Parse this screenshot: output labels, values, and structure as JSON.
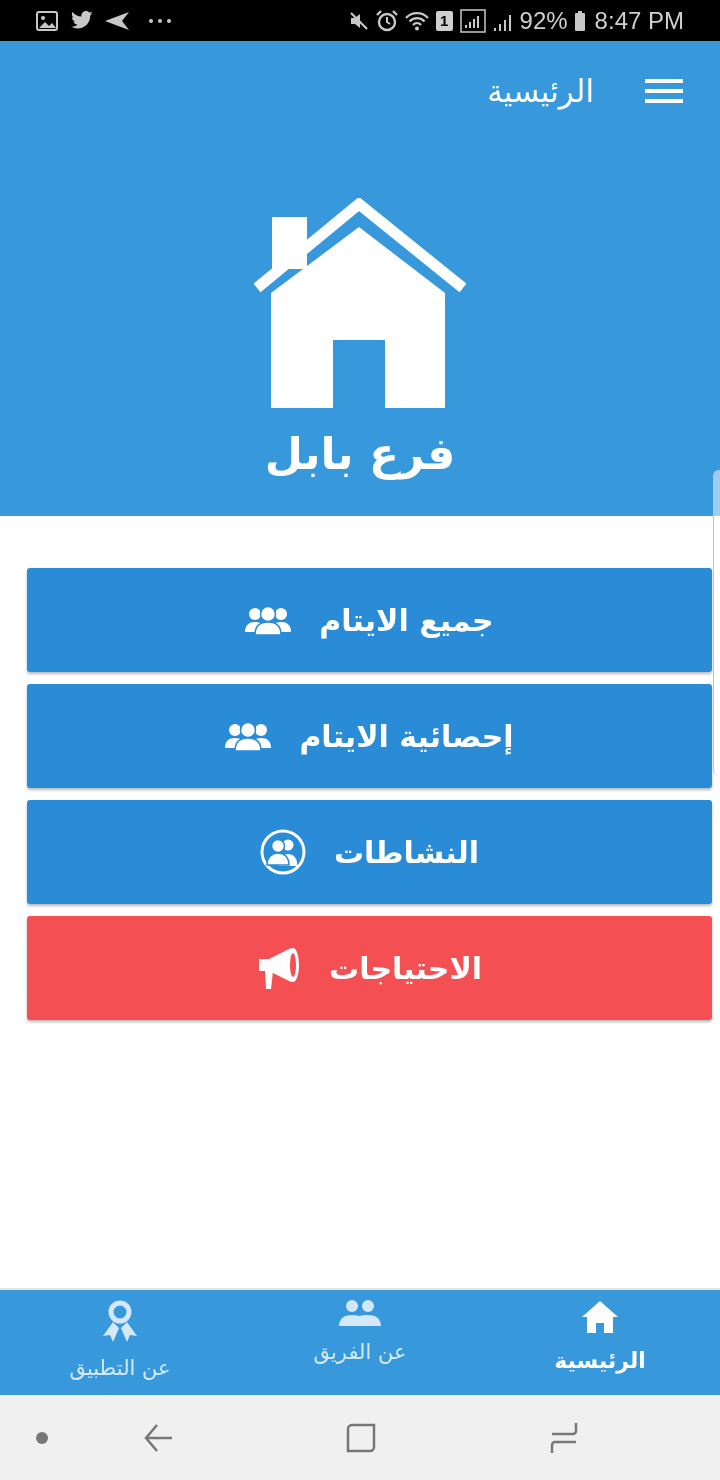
{
  "status_bar": {
    "sim_slot": "1",
    "battery": "92%",
    "time": "8:47 PM"
  },
  "app_bar": {
    "title": "الرئيسية"
  },
  "logo": {
    "caption": "فرع بابل"
  },
  "menu_buttons": [
    {
      "label": "جميع الايتام",
      "kind": "group",
      "color": "#2a8bd6"
    },
    {
      "label": "إحصائية الايتام",
      "kind": "group",
      "color": "#2a8bd6"
    },
    {
      "label": "النشاطات",
      "kind": "group-circle",
      "color": "#2a8bd6"
    },
    {
      "label": "الاحتياجات",
      "kind": "megaphone",
      "color": "#f45053"
    }
  ],
  "bottom_nav": [
    {
      "label": "الرئيسية",
      "kind": "home",
      "selected": true
    },
    {
      "label": "عن الفريق",
      "kind": "team",
      "selected": false
    },
    {
      "label": "عن التطبيق",
      "kind": "award",
      "selected": false
    }
  ]
}
